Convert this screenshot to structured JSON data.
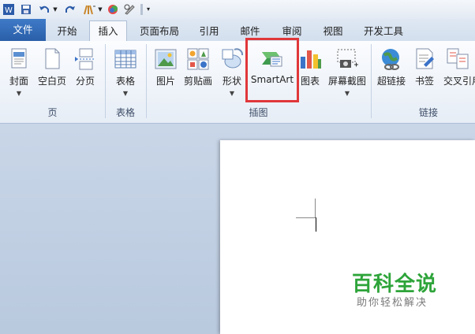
{
  "quick_access": {
    "app_icon": "word-app-icon",
    "save_icon": "save-icon",
    "undo_icon": "undo-icon",
    "redo_icon": "redo-icon",
    "format_icon": "format-painter-icon",
    "color_icon": "color-icon",
    "eraser_icon": "eraser-icon",
    "customize_icon": "customize-qat-icon"
  },
  "tabs": [
    "文件",
    "开始",
    "插入",
    "页面布局",
    "引用",
    "邮件",
    "审阅",
    "视图",
    "开发工具"
  ],
  "active_tab": "插入",
  "ribbon": {
    "page_group": {
      "label": "页",
      "buttons": [
        "封面",
        "空白页",
        "分页"
      ]
    },
    "table_group": {
      "label": "表格",
      "buttons": [
        "表格"
      ]
    },
    "illustration_group": {
      "label": "插图",
      "buttons": [
        "图片",
        "剪贴画",
        "形状",
        "SmartArt",
        "图表",
        "屏幕截图"
      ]
    },
    "link_group": {
      "label": "链接",
      "buttons": [
        "超链接",
        "书签",
        "交叉引用"
      ]
    }
  },
  "watermark": {
    "title": "百科全说",
    "subtitle": "助你轻松解决"
  },
  "colors": {
    "file_tab": "#2a5ea8",
    "highlight": "#e0373a",
    "watermark_green": "#2ea43a",
    "canvas_bg": "#c9d6e8"
  }
}
